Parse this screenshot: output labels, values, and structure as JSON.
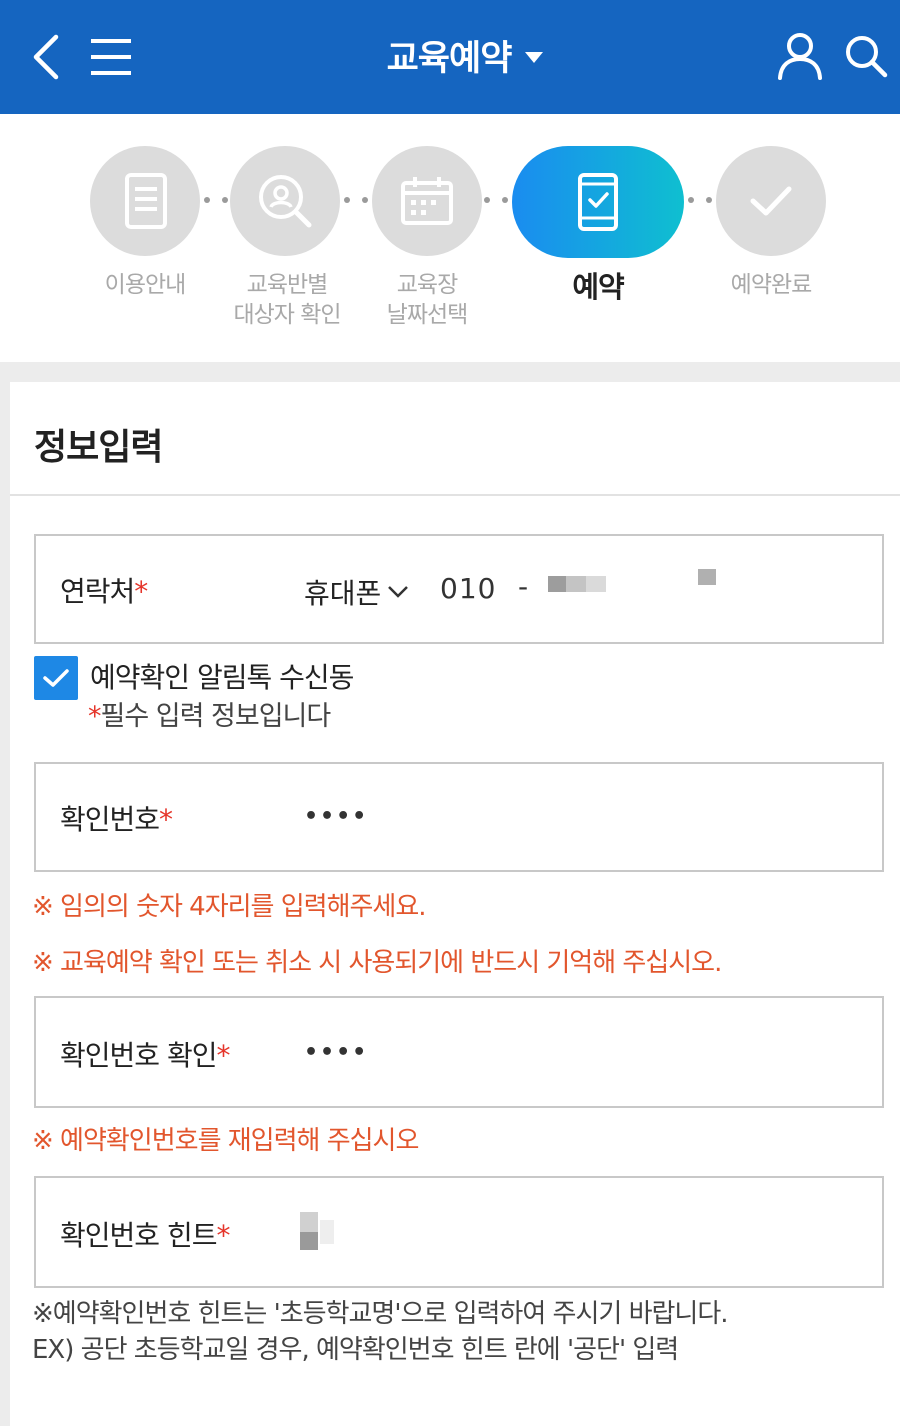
{
  "header": {
    "title": "교육예약",
    "background": "#1565c0",
    "icons": [
      "back-arrow-icon",
      "hamburger-menu-icon",
      "chevron-down-icon",
      "user-icon",
      "search-icon"
    ]
  },
  "steps": [
    {
      "label_line1": "이용안내",
      "label_line2": "",
      "icon": "document-icon",
      "active": false
    },
    {
      "label_line1": "교육반별",
      "label_line2": "대상자 확인",
      "icon": "person-search-icon",
      "active": false
    },
    {
      "label_line1": "교육장",
      "label_line2": "날짜선택",
      "icon": "calendar-icon",
      "active": false
    },
    {
      "label_line1": "예약",
      "label_line2": "",
      "icon": "tablet-check-icon",
      "active": true
    },
    {
      "label_line1": "예약완료",
      "label_line2": "",
      "icon": "checkmark-icon",
      "active": false
    }
  ],
  "section": {
    "title": "정보입력"
  },
  "contact": {
    "label": "연락처",
    "required_mark": "*",
    "phone_type": "휴대폰",
    "prefix": "010",
    "separator": "-"
  },
  "consent": {
    "checked": true,
    "label": "예약확인 알림톡 수신동",
    "note": "*필수 입력 정보입니다"
  },
  "confirm_number": {
    "label": "확인번호",
    "required_mark": "*",
    "value_masked": "••••"
  },
  "warnings": {
    "w1": "※ 임의의 숫자 4자리를 입력해주세요.",
    "w2": "※ 교육예약 확인 또는 취소 시 사용되기에 반드시 기억해 주십시오.",
    "w3": "※ 예약확인번호를 재입력해 주십시오"
  },
  "confirm_number_repeat": {
    "label": "확인번호 확인",
    "required_mark": "*",
    "value_masked": "••••"
  },
  "hint": {
    "label": "확인번호 힌트",
    "required_mark": "*",
    "note_line1": "※예약확인번호 힌트는 '초등학교명'으로 입력하여 주시기 바랍니다.",
    "note_line2": "EX) 공단 초등학교일 경우, 예약확인번호 힌트 란에 '공단' 입력"
  },
  "colors": {
    "accent": "#1e88e5",
    "warning": "#e2562d",
    "required": "#e5352a",
    "active_step_gradient_start": "#1a8cf0",
    "active_step_gradient_end": "#0fbfd0"
  }
}
